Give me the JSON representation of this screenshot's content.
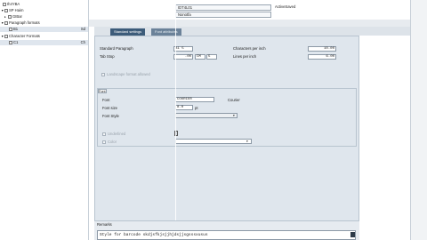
{
  "sidebar": {
    "items": [
      {
        "label": "Ih4YBA",
        "indent": 2,
        "icon": "document-icon"
      },
      {
        "label": "SP Haim",
        "indent": 1,
        "icon": "folder-icon",
        "arrow": "▼"
      },
      {
        "label": "GIBar",
        "indent": 2,
        "icon": "folder-icon",
        "arrow": "▸"
      },
      {
        "label": "Paragraph formats",
        "indent": 1,
        "icon": "folder-icon",
        "arrow": "▼"
      },
      {
        "label": "B1",
        "indent": 3,
        "icon": "document-icon",
        "selected": true,
        "suffix": "Sd"
      },
      {
        "label": "Character Formats",
        "indent": 1,
        "icon": "folder-icon",
        "arrow": "▼"
      },
      {
        "label": "C1",
        "indent": 3,
        "icon": "document-icon",
        "selected": true,
        "suffix": "Ch"
      }
    ]
  },
  "header": {
    "box1": "IDT4L01",
    "box2": "Nonotfa",
    "status": "ActiveSaved"
  },
  "tabs": [
    {
      "label": "Standard settings",
      "active": true
    },
    {
      "label": "Font attributes",
      "active": false
    }
  ],
  "standard": {
    "std_paragraph_label": "Standard Paragraph",
    "std_paragraph_value": "B1 5",
    "tab_stop_label": "Tab Stop",
    "tab_stop_value": ".00",
    "tab_stop_unit": "CM",
    "tab_stop_extra": "5",
    "chars_per_inch_label": "Characters per inch",
    "chars_per_inch_value": "10.00",
    "lines_per_inch_label": "Lines per inch",
    "lines_per_inch_value": "6.00",
    "checkbox_label": "Landscape format allowed"
  },
  "font": {
    "group_title": "Font",
    "family_label": "Font",
    "family_value": "COURIER",
    "family_desc": "Courier",
    "size_label": "Font size",
    "size_value": "8.0",
    "size_unit": "pt",
    "style_label": "Font Style",
    "underline_label": "Underlined",
    "color_label": "Color"
  },
  "description": {
    "title": "Remarks",
    "text": "Style for barcode skdjsfkjsjjhjdsjjsgsssxusus"
  }
}
